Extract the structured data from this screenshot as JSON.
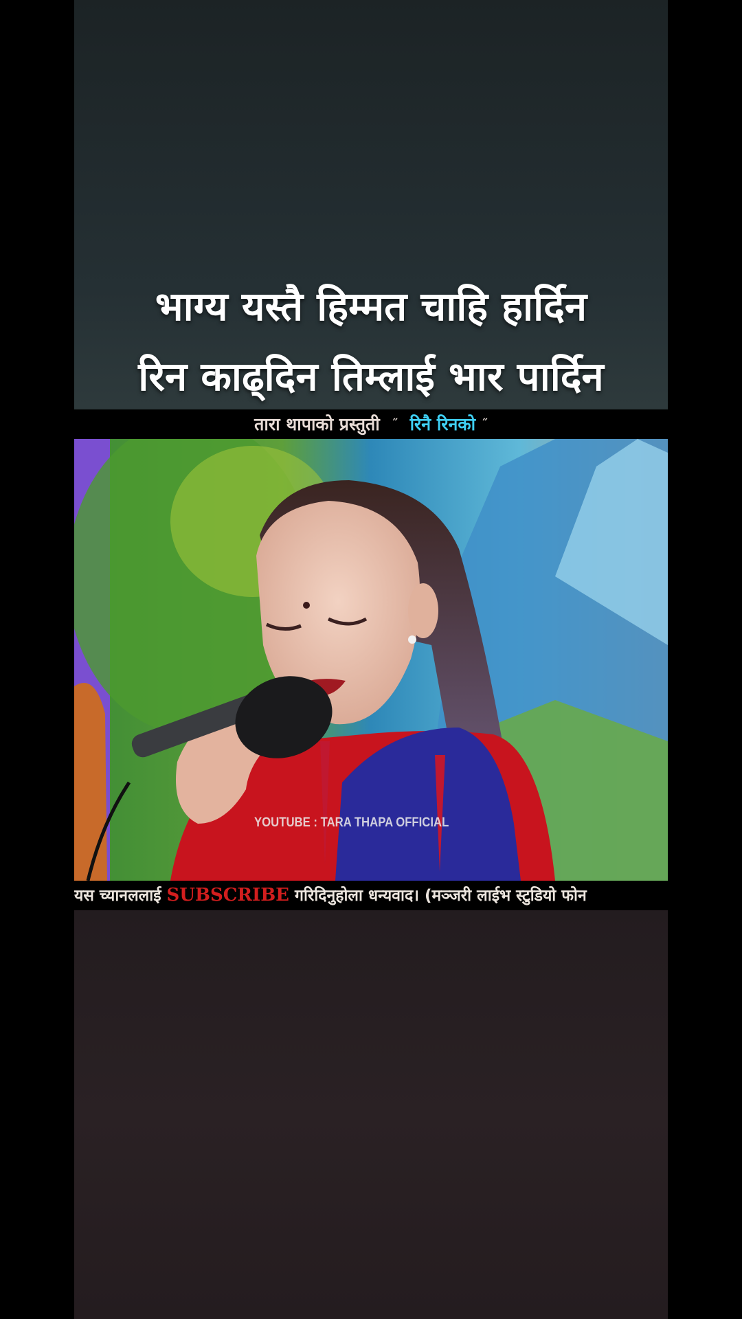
{
  "lyrics": {
    "line1": "भाग्य यस्तै हिम्मत चाहि हार्दिन",
    "line2": "रिन काढ्दिन तिम्लाई भार पार्दिन"
  },
  "title_strip": {
    "presenter": "तारा थापाको प्रस्तुती",
    "quote_open": "˝",
    "song": "रिनै रिनको",
    "quote_close": "˝"
  },
  "video": {
    "watermark": "YOUTUBE : TARA THAPA OFFICIAL"
  },
  "ticker": {
    "before": "यस च्यानललाई",
    "subscribe": "SUBSCRIBE",
    "after": "गरिदिनुहोला धन्यवाद। (मञ्जरी लाईभ स्टुडियो फोन"
  },
  "colors": {
    "song_title": "#3fd0f5",
    "subscribe": "#d21e1e"
  }
}
